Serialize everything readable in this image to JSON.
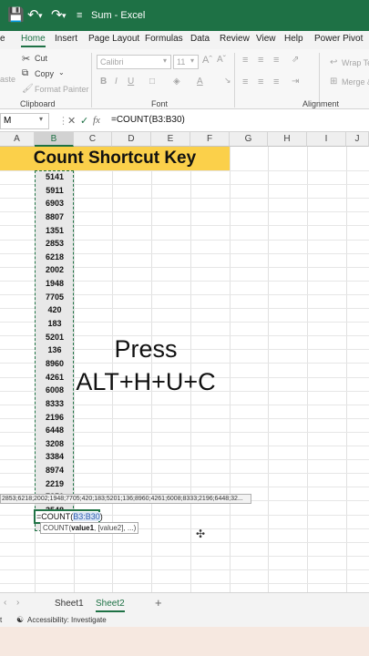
{
  "titlebar": {
    "title": "Sum  -  Excel",
    "color": "#1e7145"
  },
  "tabs": [
    "e",
    "Home",
    "Insert",
    "Page Layout",
    "Formulas",
    "Data",
    "Review",
    "View",
    "Help",
    "Power Pivot"
  ],
  "active_tab": "Home",
  "ribbon": {
    "cut": "Cut",
    "copy": "Copy",
    "format_painter": "Format Painter",
    "paste": "aste",
    "font_name": "Calibri",
    "font_size": "11",
    "wrap_text": "Wrap Tex",
    "merge": "Merge &",
    "group_clipboard": "Clipboard",
    "group_font": "Font",
    "group_alignment": "Alignment"
  },
  "formula_bar": {
    "name_box": "M",
    "formula": "=COUNT(B3:B30)"
  },
  "columns": [
    "A",
    "B",
    "C",
    "D",
    "E",
    "F",
    "G",
    "H",
    "I",
    "J"
  ],
  "selected_column": "B",
  "banner_text": "Count Shortcut Key",
  "banner_color": "#fbd04a",
  "values": [
    "5141",
    "5911",
    "6903",
    "8807",
    "1351",
    "2853",
    "6218",
    "2002",
    "1948",
    "7705",
    "420",
    "183",
    "5201",
    "136",
    "8960",
    "4261",
    "6008",
    "8333",
    "2196",
    "6448",
    "3208",
    "3384",
    "8974",
    "2219",
    "7850",
    "3548",
    "6018"
  ],
  "press_line1": "Press",
  "press_line2": "ALT+H+U+C",
  "tooltip_values": "2853;6218;2002;1948;7705;420;183;5201;136;8960;4261;6008;8333;2196;6448;32...",
  "edit_cell": {
    "prefix": "=COUNT(",
    "ref": "B3:B30",
    "suffix": ")"
  },
  "hint": {
    "func": "COUNT(",
    "arg1": "value1",
    "rest": ", [value2], ...)"
  },
  "sheets": [
    "Sheet1",
    "Sheet2"
  ],
  "active_sheet": "Sheet2",
  "status": {
    "left": "t",
    "accessibility": "Accessibility: Investigate"
  }
}
